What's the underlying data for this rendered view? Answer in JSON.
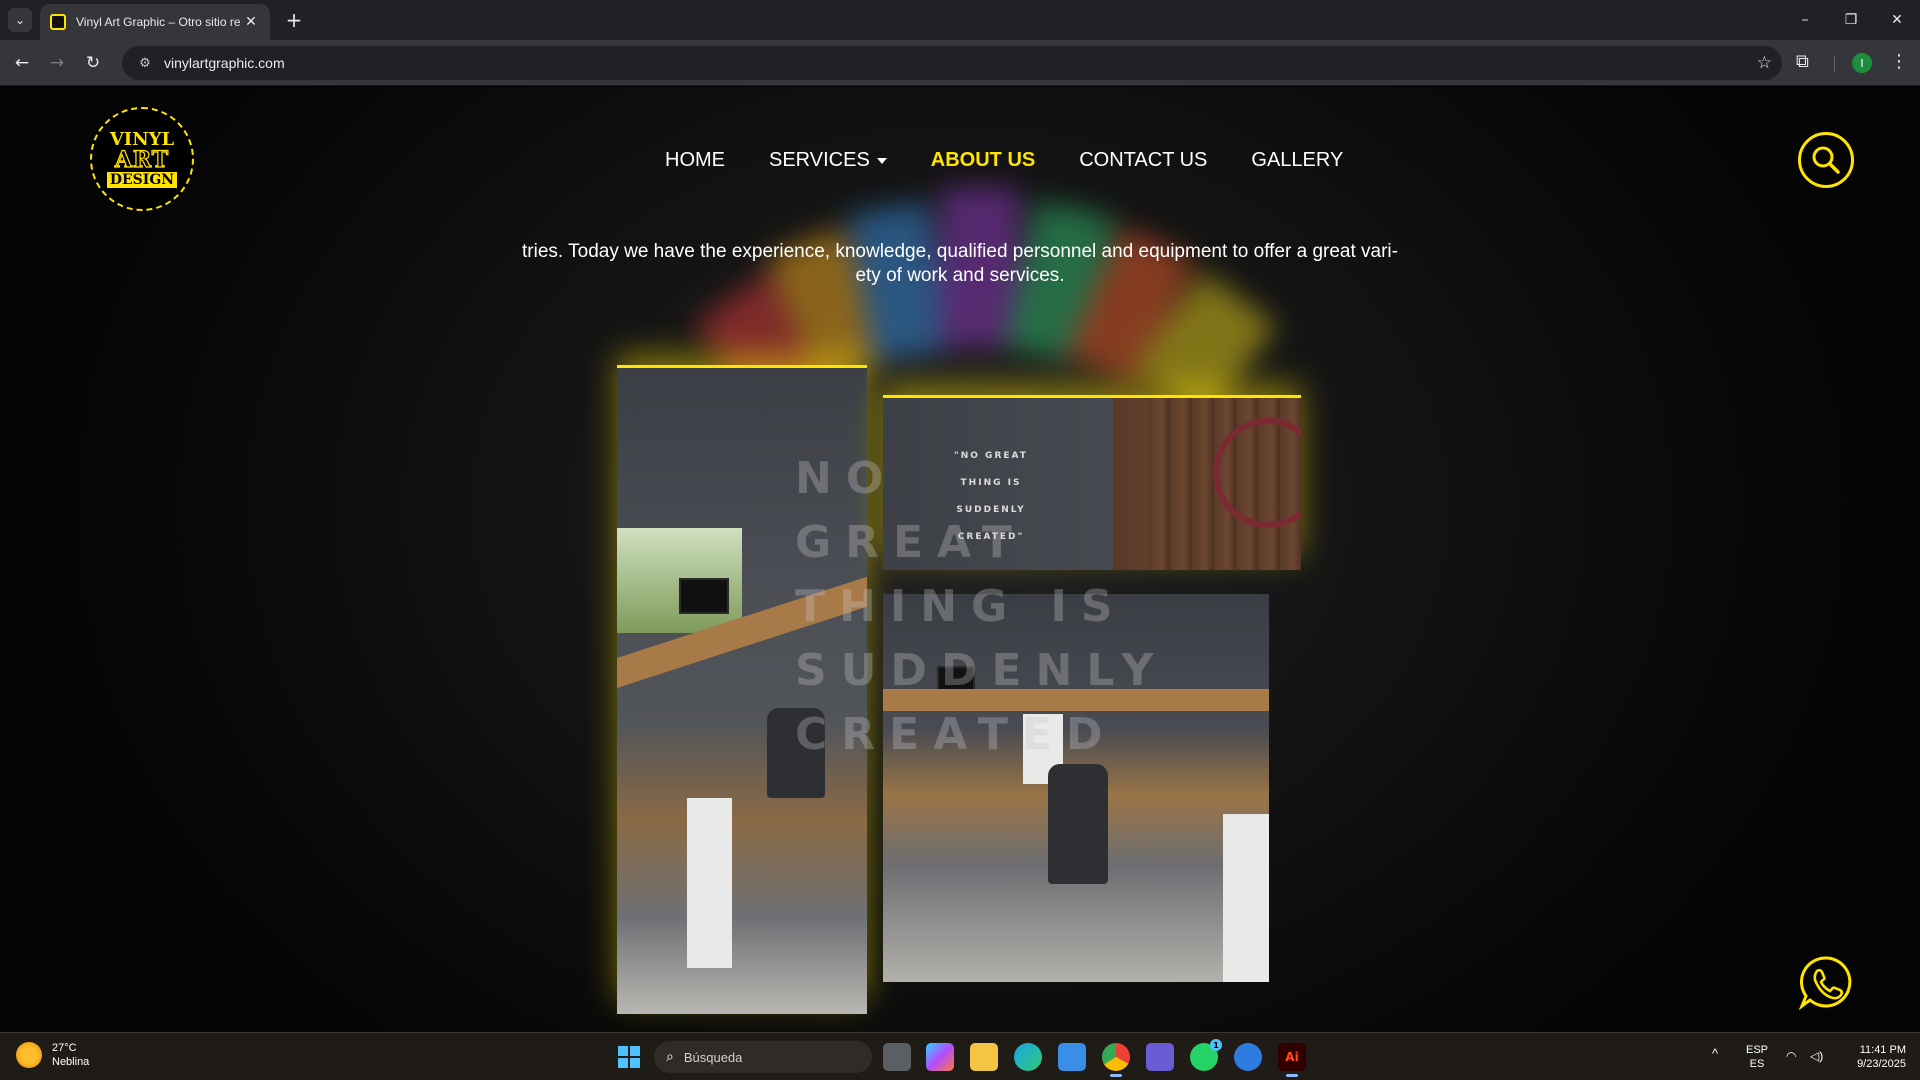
{
  "browser": {
    "tab_title": "Vinyl Art Graphic – Otro sitio re",
    "url": "vinylartgraphic.com",
    "profile_initial": "I"
  },
  "site": {
    "logo": {
      "line1": "VINYL",
      "line2": "ART",
      "line3": "DESIGN"
    },
    "nav": [
      {
        "label": "HOME",
        "active": false
      },
      {
        "label": "SERVICES",
        "active": false,
        "dropdown": true
      },
      {
        "label": "ABOUT US",
        "active": true
      },
      {
        "label": "CONTACT US",
        "active": false
      },
      {
        "label": "GALLERY",
        "active": false
      }
    ],
    "intro_text_line1": "tries. Today we have the experience, knowledge, qualified personnel and equipment to offer a great vari-",
    "intro_text_line2": "ety of work and services.",
    "wall_quote": [
      "\"NO GREAT",
      "THING IS",
      "SUDDENLY",
      "CREATED\""
    ],
    "big_wall_text": [
      "NO",
      "GREAT",
      "THING IS",
      "SUDDENLY",
      "CREATED"
    ]
  },
  "taskbar": {
    "weather_temp": "27°C",
    "weather_desc": "Neblina",
    "search_placeholder": "Búsqueda",
    "whatsapp_badge": "1",
    "lang_top": "ESP",
    "lang_bottom": "ES",
    "time": "11:41 PM",
    "date": "9/23/2025"
  },
  "colors": {
    "accent": "#ffe400",
    "background": "#0b0b0b"
  }
}
